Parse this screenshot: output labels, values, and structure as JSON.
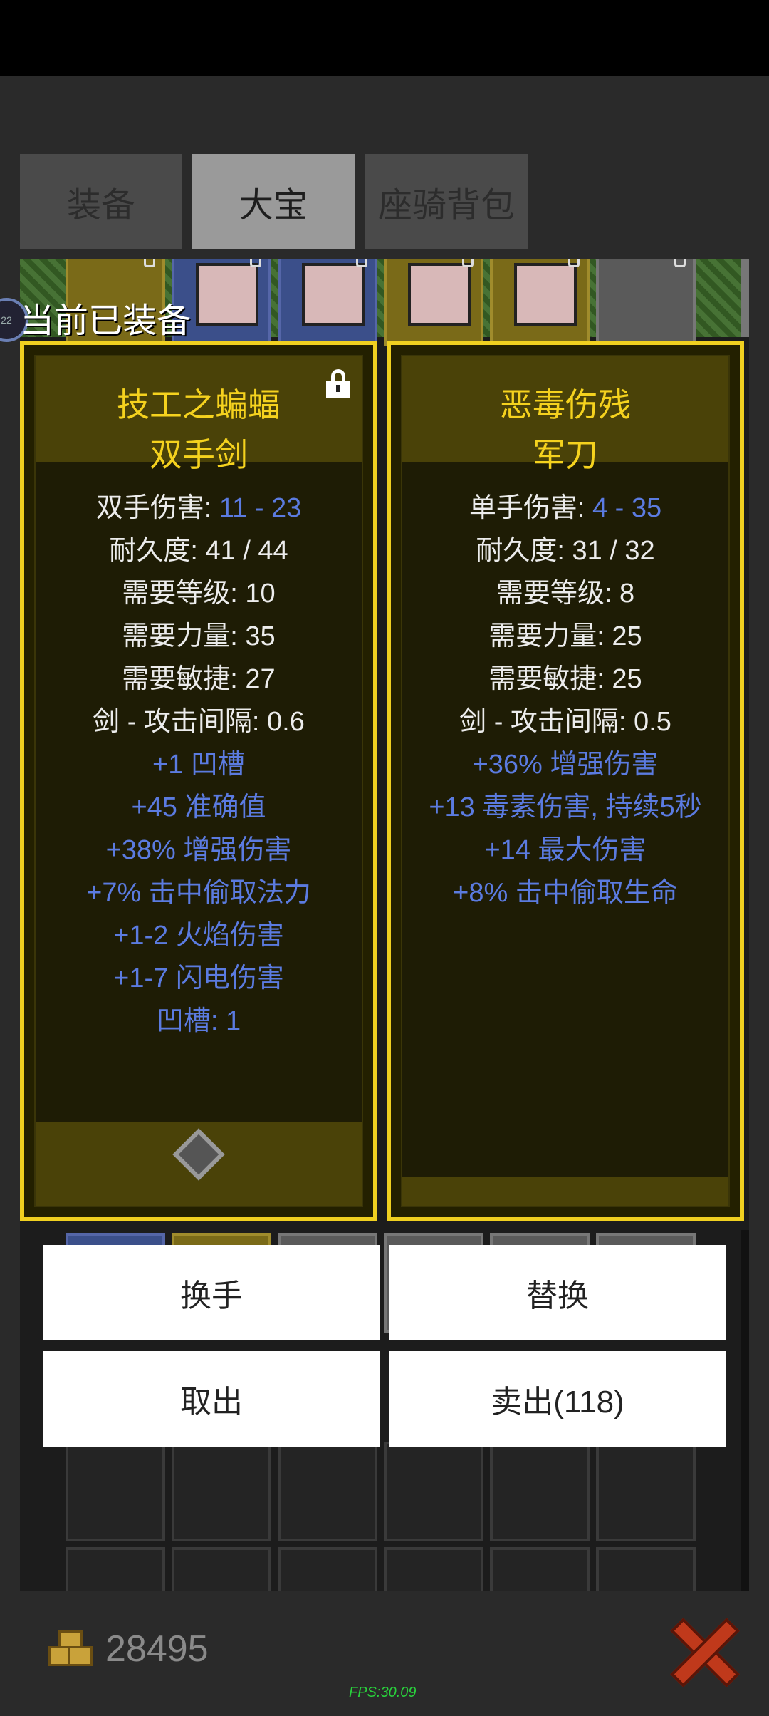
{
  "tabs": [
    {
      "label": "装备",
      "active": false
    },
    {
      "label": "大宝",
      "active": true
    },
    {
      "label": "座骑背包",
      "active": false
    }
  ],
  "equipped_label": "当前已装备",
  "level_badge": "22",
  "left_item": {
    "name": "技工之蝙蝠",
    "type": "双手剑",
    "locked": true,
    "sockets": 1,
    "damage_label": "双手伤害: ",
    "damage_value": "11 - 23",
    "durability": "耐久度: 41 / 44",
    "req_level": "需要等级: 10",
    "req_str": "需要力量: 35",
    "req_dex": "需要敏捷: 27",
    "attack_speed": "剑 - 攻击间隔: 0.6",
    "mods": [
      "+1 凹槽",
      "+45 准确值",
      "+38% 增强伤害",
      "+7% 击中偷取法力",
      "+1-2 火焰伤害",
      "+1-7 闪电伤害",
      "凹槽: 1"
    ]
  },
  "right_item": {
    "name": "恶毒伤残",
    "type": "军刀",
    "damage_label": "单手伤害: ",
    "damage_value": "4 - 35",
    "durability": "耐久度: 31 / 32",
    "req_level": "需要等级: 8",
    "req_str": "需要力量: 25",
    "req_dex": "需要敏捷: 25",
    "attack_speed": "剑 - 攻击间隔: 0.5",
    "mods": [
      "+36% 增强伤害",
      "+13 毒素伤害, 持续5秒",
      "+14 最大伤害",
      "+8% 击中偷取生命"
    ]
  },
  "buttons": {
    "swap_hand": "换手",
    "replace": "替换",
    "take_out": "取出",
    "sell": "卖出(118)"
  },
  "gold": "28495",
  "fps": "FPS:30.09",
  "colors": {
    "card_border": "#f0d020",
    "item_name": "#f5d21e",
    "magic_mod": "#5b7be0",
    "close": "#c0391b"
  },
  "icons": [
    "padlock-icon",
    "socket-icon",
    "coins-icon",
    "close-x-icon"
  ]
}
